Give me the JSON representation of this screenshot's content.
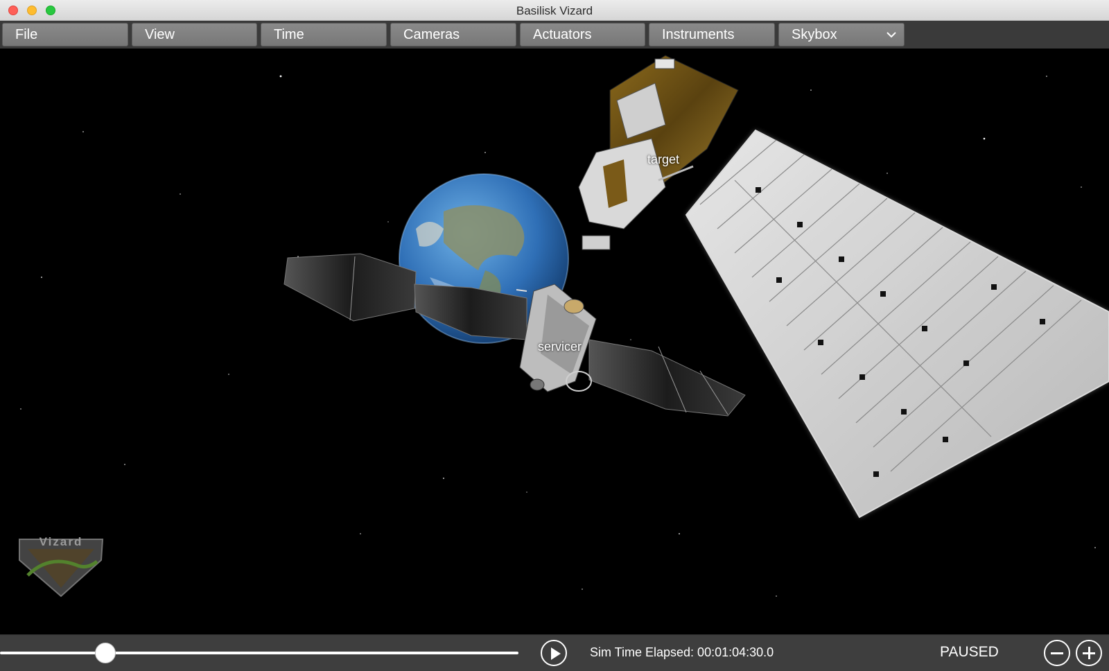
{
  "window": {
    "title": "Basilisk Vizard"
  },
  "menu": {
    "items": [
      {
        "label": "File"
      },
      {
        "label": "View"
      },
      {
        "label": "Time"
      },
      {
        "label": "Cameras"
      },
      {
        "label": "Actuators"
      },
      {
        "label": "Instruments"
      },
      {
        "label": "Skybox"
      }
    ]
  },
  "scene": {
    "labels": {
      "target": "target",
      "servicer": "servicer"
    },
    "logo_text": "Vizard"
  },
  "playback": {
    "progress": 0.2,
    "sim_time": "Sim Time Elapsed: 00:01:04:30.0",
    "status": "PAUSED"
  },
  "colors": {
    "menu_bg": "#3a3a3a",
    "button_bg": "#8a8a8a",
    "space": "#000000"
  }
}
